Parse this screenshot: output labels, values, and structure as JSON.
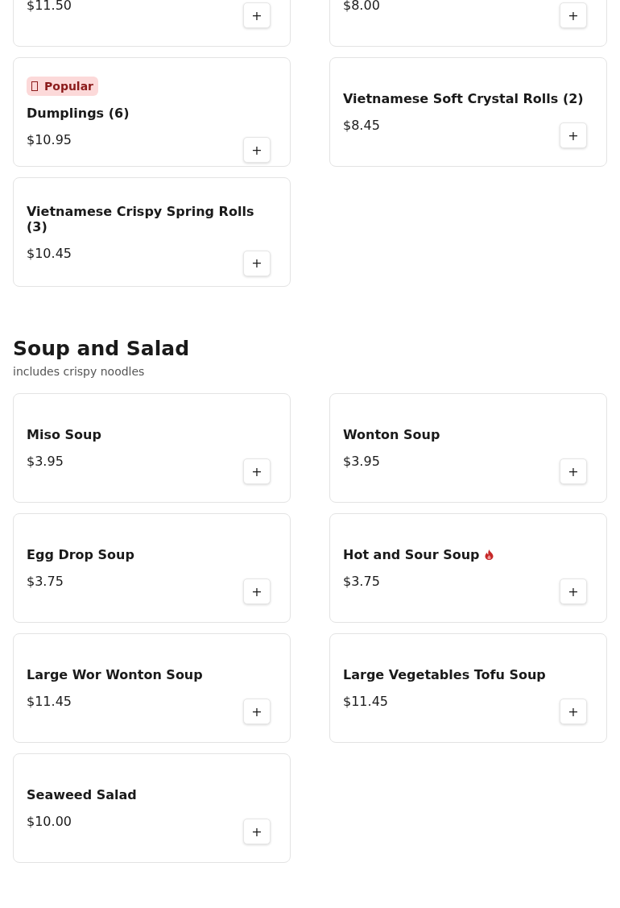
{
  "sections": [
    {
      "items": [
        {
          "price": "$11.50",
          "add": "+"
        },
        {
          "price": "$8.00",
          "add": "+"
        },
        {
          "badge": "Popular",
          "name": "Dumplings (6)",
          "price": "$10.95",
          "spicy": false,
          "add": "+"
        },
        {
          "name": "Vietnamese Soft Crystal Rolls (2)",
          "price": "$8.45",
          "spicy": false,
          "add": "+"
        },
        {
          "name": "Vietnamese Crispy Spring Rolls (3)",
          "price": "$10.45",
          "spicy": false,
          "add": "+"
        }
      ]
    },
    {
      "title": "Soup and Salad",
      "subtitle": "includes crispy noodles",
      "items": [
        {
          "name": "Miso Soup",
          "price": "$3.95",
          "spicy": false,
          "add": "+"
        },
        {
          "name": "Wonton Soup",
          "price": "$3.95",
          "spicy": false,
          "add": "+"
        },
        {
          "name": "Egg Drop Soup",
          "price": "$3.75",
          "spicy": false,
          "add": "+"
        },
        {
          "name": "Hot and Sour Soup",
          "price": "$3.75",
          "spicy": true,
          "add": "+"
        },
        {
          "name": "Large Wor Wonton Soup",
          "price": "$11.45",
          "spicy": false,
          "add": "+"
        },
        {
          "name": "Large Vegetables Tofu Soup",
          "price": "$11.45",
          "spicy": false,
          "add": "+"
        },
        {
          "name": "Seaweed Salad",
          "price": "$10.00",
          "spicy": false,
          "add": "+"
        }
      ]
    }
  ]
}
